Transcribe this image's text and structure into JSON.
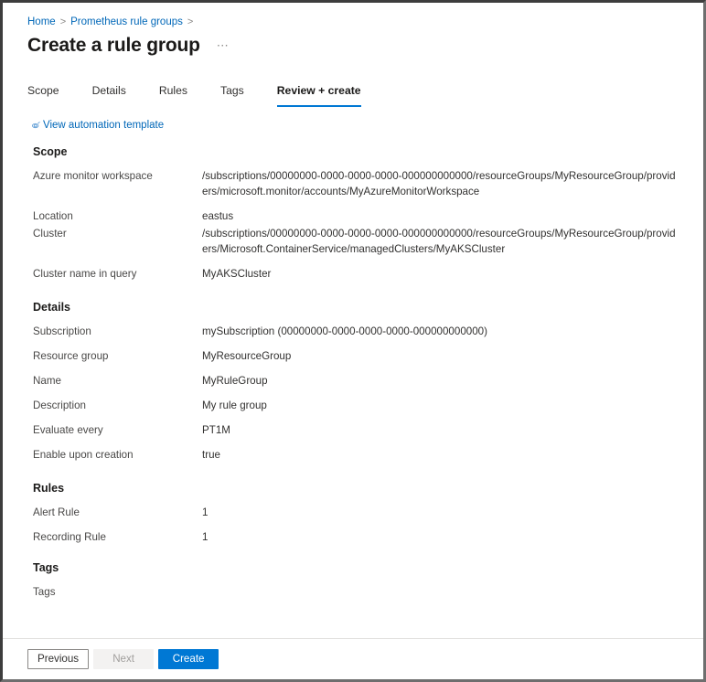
{
  "breadcrumb": {
    "items": [
      {
        "label": "Home"
      },
      {
        "label": "Prometheus rule groups"
      }
    ],
    "separator": ">"
  },
  "header": {
    "title": "Create a rule group",
    "ellipsis": "⋯"
  },
  "tabs": [
    {
      "label": "Scope",
      "active": false
    },
    {
      "label": "Details",
      "active": false
    },
    {
      "label": "Rules",
      "active": false
    },
    {
      "label": "Tags",
      "active": false
    },
    {
      "label": "Review + create",
      "active": true
    }
  ],
  "automation_link": {
    "label": "View automation template",
    "icon": "automation-template-icon"
  },
  "sections": {
    "scope": {
      "heading": "Scope",
      "rows": [
        {
          "label": "Azure monitor workspace",
          "value": "/subscriptions/00000000-0000-0000-0000-000000000000/resourceGroups/MyResourceGroup/providers/microsoft.monitor/accounts/MyAzureMonitorWorkspace"
        },
        {
          "label": "Location",
          "value": "eastus"
        },
        {
          "label": "Cluster",
          "value": "/subscriptions/00000000-0000-0000-0000-000000000000/resourceGroups/MyResourceGroup/providers/Microsoft.ContainerService/managedClusters/MyAKSCluster"
        },
        {
          "label": "Cluster name in query",
          "value": "MyAKSCluster"
        }
      ]
    },
    "details": {
      "heading": "Details",
      "rows": [
        {
          "label": "Subscription",
          "value": "mySubscription (00000000-0000-0000-0000-000000000000)"
        },
        {
          "label": "Resource group",
          "value": "MyResourceGroup"
        },
        {
          "label": "Name",
          "value": "MyRuleGroup"
        },
        {
          "label": "Description",
          "value": "My rule group"
        },
        {
          "label": "Evaluate every",
          "value": "PT1M"
        },
        {
          "label": "Enable upon creation",
          "value": "true"
        }
      ]
    },
    "rules": {
      "heading": "Rules",
      "rows": [
        {
          "label": "Alert Rule",
          "value": "1"
        },
        {
          "label": "Recording Rule",
          "value": "1"
        }
      ]
    },
    "tags": {
      "heading": "Tags",
      "rows": [
        {
          "label": "Tags",
          "value": ""
        }
      ]
    }
  },
  "footer": {
    "previous_label": "Previous",
    "next_label": "Next",
    "create_label": "Create"
  },
  "colors": {
    "accent": "#0078d4",
    "link": "#0067b8",
    "text": "#323130",
    "label": "#494847",
    "heading": "#1b1a19",
    "disabled": "#a19f9d",
    "divider": "#e1dfdd"
  }
}
